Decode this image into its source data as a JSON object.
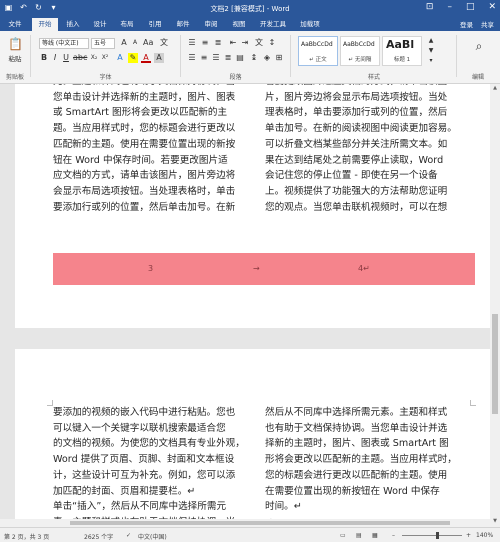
{
  "title_bar": {
    "doc_title": "文档2 [兼容模式] - Word",
    "qat_icons": [
      "save-icon",
      "undo-icon",
      "redo-icon",
      "customize-icon"
    ],
    "window_buttons": [
      "⊡",
      "–",
      "□",
      "✕"
    ]
  },
  "tabs": [
    {
      "label": "文件"
    },
    {
      "label": "开始"
    },
    {
      "label": "插入"
    },
    {
      "label": "设计"
    },
    {
      "label": "布局"
    },
    {
      "label": "引用"
    },
    {
      "label": "邮件"
    },
    {
      "label": "审阅"
    },
    {
      "label": "视图"
    },
    {
      "label": "开发工具"
    },
    {
      "label": "加载项"
    }
  ],
  "tab_right": {
    "login": "登录",
    "share": "共享"
  },
  "ribbon": {
    "clipboard_label": "剪贴板",
    "paste_label": "粘贴",
    "font_label": "字体",
    "font_name": "等线 (中文正)",
    "font_size": "五号",
    "paragraph_label": "段落",
    "styles_label": "样式",
    "editing_label": "编辑",
    "styles": [
      {
        "sample": "AaBbCcDd",
        "name": "↵ 正文"
      },
      {
        "sample": "AaBbCcDd",
        "name": "↵ 无间隔"
      },
      {
        "sample": "AaBl",
        "name": "标题 1"
      }
    ]
  },
  "page1": {
    "left_col": "元。主题和样式也有助于文档保持协调。当\n您单击设计并选择新的主题时，图片、图表\n或 SmartArt 图形将会更改以匹配新的主\n题。当应用样式时，您的标题会进行更改以\n匹配新的主题。使用在需要位置出现的新按\n钮在 Word 中保存时间。若要更改图片适\n应文档的方式，请单击该图片，图片旁边将\n会显示布局选项按钮。当处理表格时，单击\n要添加行或列的位置，然后单击加号。在新",
    "right_col": "若要更改图片适应文档的方式，请单击该图\n片，图片旁边将会显示布局选项按钮。当处\n理表格时，单击要添加行或列的位置，然后\n单击加号。在新的阅读视图中阅读更加容易。\n可以折叠文档某些部分并关注所需文本。如\n果在达到结尾处之前需要停止读取，Word\n会记住您的停止位置 - 即使在另一个设备\n上。视频提供了功能强大的方法帮助您证明\n您的观点。当您单击联机视频时，可以在想",
    "footer_left": "3",
    "footer_arrow": "→",
    "footer_right": "4↵"
  },
  "page2": {
    "left_col": "要添加的视频的嵌入代码中进行粘贴。您也\n可以键入一个关键字以联机搜索最适合您\n的文档的视频。为使您的文档具有专业外观，\nWord 提供了页眉、页脚、封面和文本框设\n计，这些设计可互为补充。例如，您可以添\n加匹配的封面、页眉和提要栏。↵\n单击“插入”，然后从不同库中选择所需元\n素。主题和样式也有助于文档保持协调。当",
    "right_col": "然后从不同库中选择所需元素。主题和样式\n也有助于文档保持协调。当您单击设计并选\n择新的主题时，图片、图表或 SmartArt 图\n形将会更改以匹配新的主题。当应用样式时，\n您的标题会进行更改以匹配新的主题。使用\n在需要位置出现的新按钮在 Word 中保存\n时间。↵\n↵"
  },
  "status_bar": {
    "page_info": "第 2 页，共 3 页",
    "word_count": "2625 个字",
    "language": "中文(中国)",
    "zoom": "140%"
  }
}
